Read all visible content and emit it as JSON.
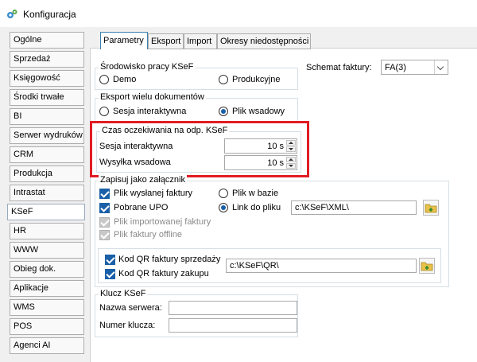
{
  "window": {
    "title": "Konfiguracja"
  },
  "sidebar": {
    "items": [
      {
        "label": "Ogólne"
      },
      {
        "label": "Sprzedaż"
      },
      {
        "label": "Księgowość"
      },
      {
        "label": "Środki trwałe"
      },
      {
        "label": "BI"
      },
      {
        "label": "Serwer wydruków"
      },
      {
        "label": "CRM"
      },
      {
        "label": "Produkcja"
      },
      {
        "label": "Intrastat"
      },
      {
        "label": "KSeF"
      },
      {
        "label": "HR"
      },
      {
        "label": "WWW"
      },
      {
        "label": "Obieg dok."
      },
      {
        "label": "Aplikacje"
      },
      {
        "label": "WMS"
      },
      {
        "label": "POS"
      },
      {
        "label": "Agenci AI"
      }
    ],
    "active": "KSeF"
  },
  "tabs": [
    {
      "label": "Parametry"
    },
    {
      "label": "Eksport"
    },
    {
      "label": "Import"
    },
    {
      "label": "Okresy niedostępności"
    }
  ],
  "srodowisko": {
    "legend": "Środowisko pracy KSeF",
    "demo": "Demo",
    "produkcyjne": "Produkcyjne"
  },
  "schemat": {
    "label": "Schemat faktury:",
    "value": "FA(3)"
  },
  "eksport": {
    "legend": "Eksport wielu dokumentów",
    "sesja": "Sesja interaktywna",
    "plik": "Plik wsadowy"
  },
  "czas": {
    "legend": "Czas oczekiwania na odp. KSeF",
    "sesja_label": "Sesja interaktywna",
    "sesja_value": "10 s",
    "wysylka_label": "Wysyłka wsadowa",
    "wysylka_value": "10 s"
  },
  "zapisuj": {
    "legend": "Zapisuj jako załącznik",
    "plik_wyslanej": "Plik wysłanej faktury",
    "pobrane_upo": "Pobrane UPO",
    "plik_importowanej": "Plik importowanej faktury",
    "plik_offline": "Plik faktury offline",
    "plik_w_bazie": "Plik w bazie",
    "link_do_pliku": "Link do pliku",
    "path_xml": "c:\\KSeF\\XML\\",
    "kod_qr_sprzedazy": "Kod QR faktury sprzedaży",
    "kod_qr_zakupu": "Kod QR faktury zakupu",
    "path_qr": "c:\\KSeF\\QR\\"
  },
  "klucz": {
    "legend": "Klucz KSeF",
    "nazwa_serwera": "Nazwa serwera:",
    "numer_klucza": "Numer klucza:"
  },
  "colors": {
    "accent": "#1a5fa8",
    "highlight": "#e11c24"
  }
}
